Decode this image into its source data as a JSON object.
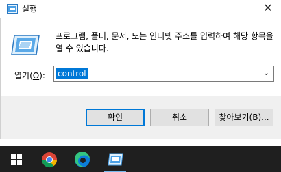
{
  "dialog": {
    "title": "실행",
    "close_glyph": "✕",
    "description": "프로그램, 폴더, 문서, 또는 인터넷 주소를 입력하여 해당 항목을 열 수 있습니다.",
    "open_label_prefix": "열기(",
    "open_label_accel": "O",
    "open_label_suffix": "):",
    "open_value": "control",
    "buttons": {
      "ok": "확인",
      "cancel": "취소",
      "browse_prefix": "찾아보기(",
      "browse_accel": "B",
      "browse_suffix": ")..."
    }
  },
  "taskbar": {
    "items": [
      "windows-start",
      "chrome",
      "edge",
      "run"
    ]
  },
  "colors": {
    "selection": "#0078d7",
    "taskbar": "#1f1f1f",
    "footer": "#f0f0f0",
    "ok_border": "#0078d7"
  }
}
